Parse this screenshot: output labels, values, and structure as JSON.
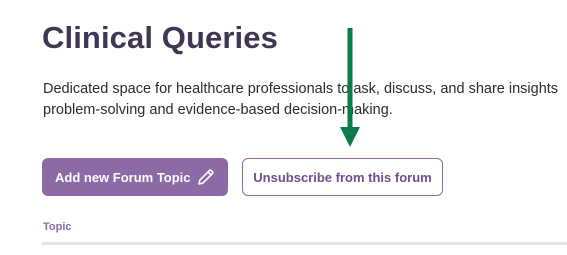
{
  "forum": {
    "title": "Clinical Queries",
    "description_line1": "Dedicated space for healthcare professionals to ask, discuss, and share insights",
    "description_line2": "problem-solving and evidence-based decision-making."
  },
  "actions": {
    "add_topic_label": "Add new Forum Topic",
    "unsubscribe_label": "Unsubscribe from this forum"
  },
  "table": {
    "columns": [
      "Topic"
    ]
  },
  "icons": {
    "add_topic_icon": "pencil-icon",
    "annotation_arrow": "arrow-down-icon"
  },
  "colors": {
    "title": "#3f3652",
    "accent": "#8b6aa6",
    "annotation_arrow": "#0e7a4e"
  }
}
